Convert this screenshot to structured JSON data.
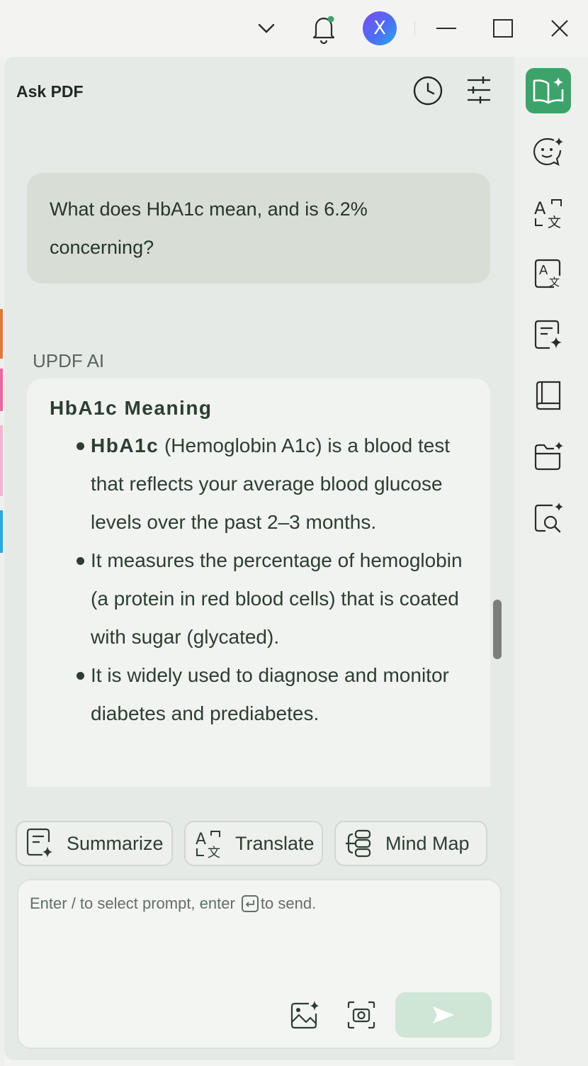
{
  "window": {
    "icons": [
      "chevron-down-icon",
      "bell-icon",
      "minimize-icon",
      "maximize-icon",
      "close-icon"
    ],
    "avatar_initial": "X",
    "notification_color": "#3ea36a"
  },
  "panel": {
    "title": "Ask PDF",
    "header_icons": [
      "history-clock-icon",
      "settings-sliders-icon"
    ]
  },
  "chat": {
    "user_message": "What does HbA1c mean, and is 6.2% concerning?",
    "ai_label": "UPDF AI",
    "ai_response": {
      "heading": "HbA1c Meaning",
      "bullets": [
        {
          "bold": "HbA1c",
          "text": " (Hemoglobin A1c) is a blood test that reflects your average blood glucose levels over the past 2–3 months."
        },
        {
          "bold": "",
          "text": "It measures the percentage of hemoglobin (a protein in red blood cells) that is coated with sugar (glycated)."
        },
        {
          "bold": "",
          "text": "It is widely used to diagnose and monitor diabetes and prediabetes."
        }
      ]
    }
  },
  "quick_actions": [
    {
      "label": "Summarize",
      "icon": "summarize-icon"
    },
    {
      "label": "Translate",
      "icon": "translate-icon"
    },
    {
      "label": "Mind Map",
      "icon": "mind-map-icon"
    }
  ],
  "composer": {
    "placeholder_before": "Enter / to select prompt, enter ",
    "placeholder_after": "to send.",
    "icons": [
      "image-upload-icon",
      "screenshot-icon",
      "send-icon"
    ]
  },
  "sidebar": {
    "items": [
      "ask-pdf-icon",
      "chat-ai-icon",
      "translate-icon",
      "translate-doc-icon",
      "ai-summary-icon",
      "book-icon",
      "ai-folder-icon",
      "ai-search-icon"
    ],
    "accent": "#3ea36a"
  }
}
